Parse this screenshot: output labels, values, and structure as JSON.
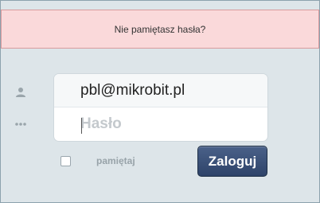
{
  "alert": {
    "forgot_password_text": "Nie pamiętasz hasła?"
  },
  "login_form": {
    "email_value": "pbl@mikrobit.pl",
    "password_placeholder": "Hasło",
    "remember_label": "pamiętaj",
    "remember_checked": false,
    "submit_label": "Zaloguj"
  },
  "icons": {
    "user": "user-icon",
    "password": "password-dots-icon"
  },
  "colors": {
    "background": "#dde5e9",
    "alert_background": "#fad9da",
    "alert_border": "#d89b9d",
    "button_background": "#3a5078",
    "label_muted": "#98a3a9"
  }
}
